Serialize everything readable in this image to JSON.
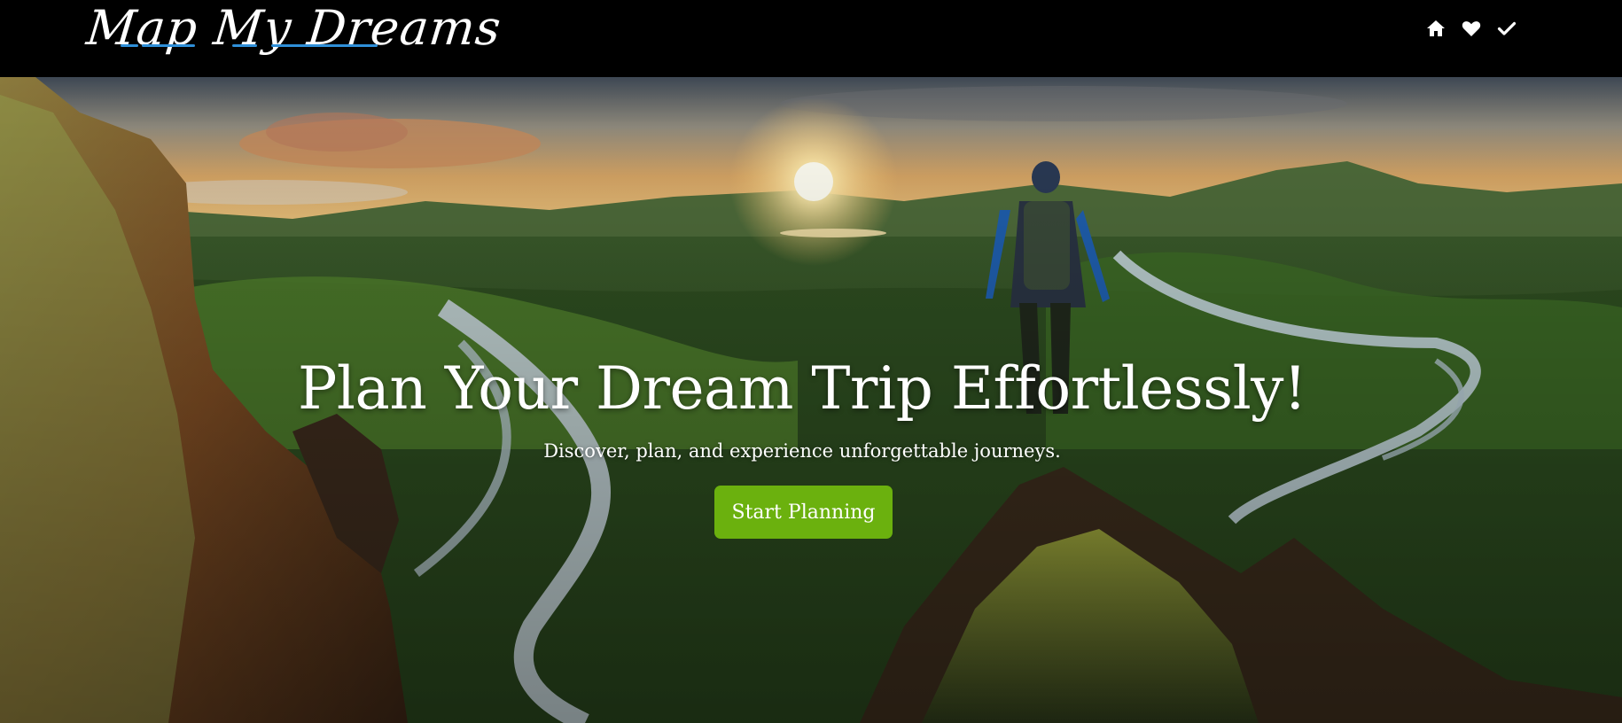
{
  "navbar": {
    "logo_text": "Map My Dreams",
    "icons": [
      {
        "name": "home-icon"
      },
      {
        "name": "heart-icon"
      },
      {
        "name": "checkmark-icon"
      }
    ]
  },
  "hero": {
    "title": "Plan Your Dream Trip Effortlessly!",
    "subtitle": "Discover, plan, and experience unforgettable journeys.",
    "cta_label": "Start Planning"
  },
  "colors": {
    "navbar_bg": "#000000",
    "accent_underline": "#2f8fd8",
    "cta_bg": "#6bb10e",
    "text": "#ffffff"
  }
}
